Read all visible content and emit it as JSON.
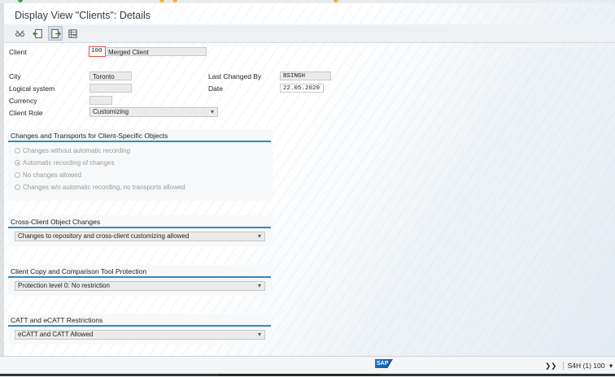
{
  "window": {
    "title": "Display View \"Clients\": Details"
  },
  "toolbar": {
    "buttons": [
      {
        "icon": "glasses-toggle-icon"
      },
      {
        "icon": "previous-entry-icon"
      },
      {
        "icon": "next-entry-icon"
      },
      {
        "icon": "variable-list-icon"
      }
    ]
  },
  "fields": {
    "client_label": "Client",
    "client_number": "100",
    "client_name": "Merged Client",
    "city_label": "City",
    "city_value": "Toronto",
    "last_changed_by_label": "Last Changed By",
    "last_changed_by_value": "BSINGH",
    "logical_system_label": "Logical system",
    "logical_system_value": "",
    "date_label": "Date",
    "date_value": "22.05.2020",
    "currency_label": "Currency",
    "currency_value": "",
    "client_role_label": "Client Role",
    "client_role_value": "Customizing"
  },
  "changes_transports": {
    "title": "Changes and Transports for Client-Specific Objects",
    "options": [
      {
        "label": "Changes without automatic recording",
        "selected": false
      },
      {
        "label": "Automatic recording of changes",
        "selected": true
      },
      {
        "label": "No changes allowed",
        "selected": false
      },
      {
        "label": "Changes w/o automatic recording, no transports allowed",
        "selected": false
      }
    ]
  },
  "cross_client": {
    "title": "Cross-Client Object Changes",
    "value": "Changes to repository and cross-client customizing allowed"
  },
  "copy_protection": {
    "title": "Client Copy and Comparison Tool Protection",
    "value": "Protection level 0: No restriction"
  },
  "catt": {
    "title": "CATT and eCATT Restrictions",
    "value": "eCATT and CATT Allowed"
  },
  "status_bar": {
    "logo_text": "SAP",
    "chevron": "❯❯",
    "system": "S4H (1) 100",
    "dropdown_glyph": "▾"
  },
  "colors": {
    "accent": "#2d8bc1",
    "highlight_border": "#e05050"
  }
}
